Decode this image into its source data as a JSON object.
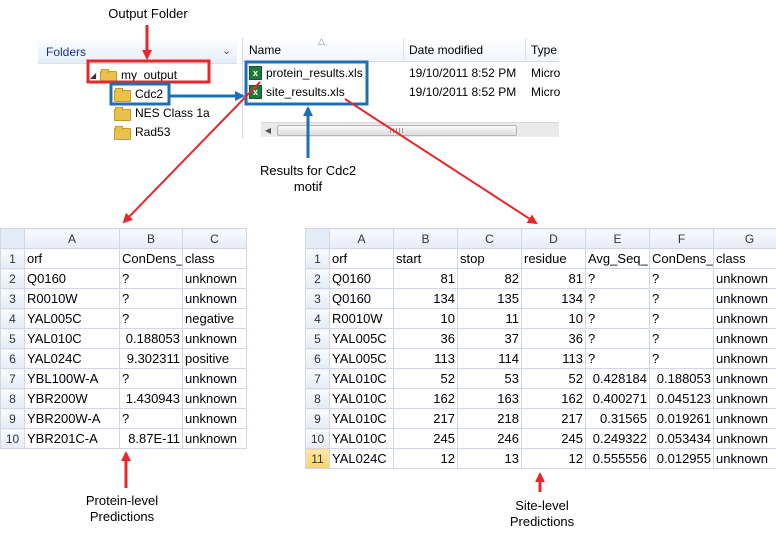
{
  "captions": {
    "output_folder": "Output Folder",
    "results_line1": "Results  for  Cdc2",
    "results_line2": "motif",
    "protein_line1": "Protein-level",
    "protein_line2": "Predictions",
    "site_line1": "Site-level",
    "site_line2": "Predictions"
  },
  "explorer": {
    "folders_label": "Folders",
    "folders": [
      {
        "label": "my_output",
        "expanded": true
      },
      {
        "label": "Cdc2",
        "selected": true
      },
      {
        "label": "NES Class 1a"
      },
      {
        "label": "Rad53"
      }
    ],
    "columns": [
      "Name",
      "Date modified",
      "Type"
    ],
    "files": [
      {
        "name": "protein_results.xls",
        "date": "19/10/2011 8:52 PM",
        "type": "Micro"
      },
      {
        "name": "site_results.xls",
        "date": "19/10/2011 8:52 PM",
        "type": "Micro"
      }
    ]
  },
  "colors": {
    "red_arrow": "#e8262b",
    "blue_arrow": "#1f6fb5",
    "red_box": "#e8262b",
    "blue_box": "#1f6fb5"
  },
  "protein_sheet": {
    "col_letters": [
      "A",
      "B",
      "C"
    ],
    "rows": [
      {
        "n": "1",
        "cells": [
          "orf",
          "ConDens_",
          "class"
        ]
      },
      {
        "n": "2",
        "cells": [
          "Q0160",
          "?",
          "unknown"
        ]
      },
      {
        "n": "3",
        "cells": [
          "R0010W",
          "?",
          "unknown"
        ]
      },
      {
        "n": "4",
        "cells": [
          "YAL005C",
          "?",
          "negative"
        ]
      },
      {
        "n": "5",
        "cells": [
          "YAL010C",
          "0.188053",
          "unknown"
        ]
      },
      {
        "n": "6",
        "cells": [
          "YAL024C",
          "9.302311",
          "positive"
        ]
      },
      {
        "n": "7",
        "cells": [
          "YBL100W-A",
          "?",
          "unknown"
        ]
      },
      {
        "n": "8",
        "cells": [
          "YBR200W",
          "1.430943",
          "unknown"
        ]
      },
      {
        "n": "9",
        "cells": [
          "YBR200W-A",
          "?",
          "unknown"
        ]
      },
      {
        "n": "10",
        "cells": [
          "YBR201C-A",
          "8.87E-11",
          "unknown"
        ]
      }
    ]
  },
  "site_sheet": {
    "col_letters": [
      "A",
      "B",
      "C",
      "D",
      "E",
      "F",
      "G"
    ],
    "selected_row": "11",
    "rows": [
      {
        "n": "1",
        "cells": [
          "orf",
          "start",
          "stop",
          "residue",
          "Avg_Seq_",
          "ConDens_",
          "class"
        ]
      },
      {
        "n": "2",
        "cells": [
          "Q0160",
          "81",
          "82",
          "81",
          "?",
          "?",
          "unknown"
        ]
      },
      {
        "n": "3",
        "cells": [
          "Q0160",
          "134",
          "135",
          "134",
          "?",
          "?",
          "unknown"
        ]
      },
      {
        "n": "4",
        "cells": [
          "R0010W",
          "10",
          "11",
          "10",
          "?",
          "?",
          "unknown"
        ]
      },
      {
        "n": "5",
        "cells": [
          "YAL005C",
          "36",
          "37",
          "36",
          "?",
          "?",
          "unknown"
        ]
      },
      {
        "n": "6",
        "cells": [
          "YAL005C",
          "113",
          "114",
          "113",
          "?",
          "?",
          "unknown"
        ]
      },
      {
        "n": "7",
        "cells": [
          "YAL010C",
          "52",
          "53",
          "52",
          "0.428184",
          "0.188053",
          "unknown"
        ]
      },
      {
        "n": "8",
        "cells": [
          "YAL010C",
          "162",
          "163",
          "162",
          "0.400271",
          "0.045123",
          "unknown"
        ]
      },
      {
        "n": "9",
        "cells": [
          "YAL010C",
          "217",
          "218",
          "217",
          "0.31565",
          "0.019261",
          "unknown"
        ]
      },
      {
        "n": "10",
        "cells": [
          "YAL010C",
          "245",
          "246",
          "245",
          "0.249322",
          "0.053434",
          "unknown"
        ]
      },
      {
        "n": "11",
        "cells": [
          "YAL024C",
          "12",
          "13",
          "12",
          "0.555556",
          "0.012955",
          "unknown"
        ]
      }
    ]
  }
}
